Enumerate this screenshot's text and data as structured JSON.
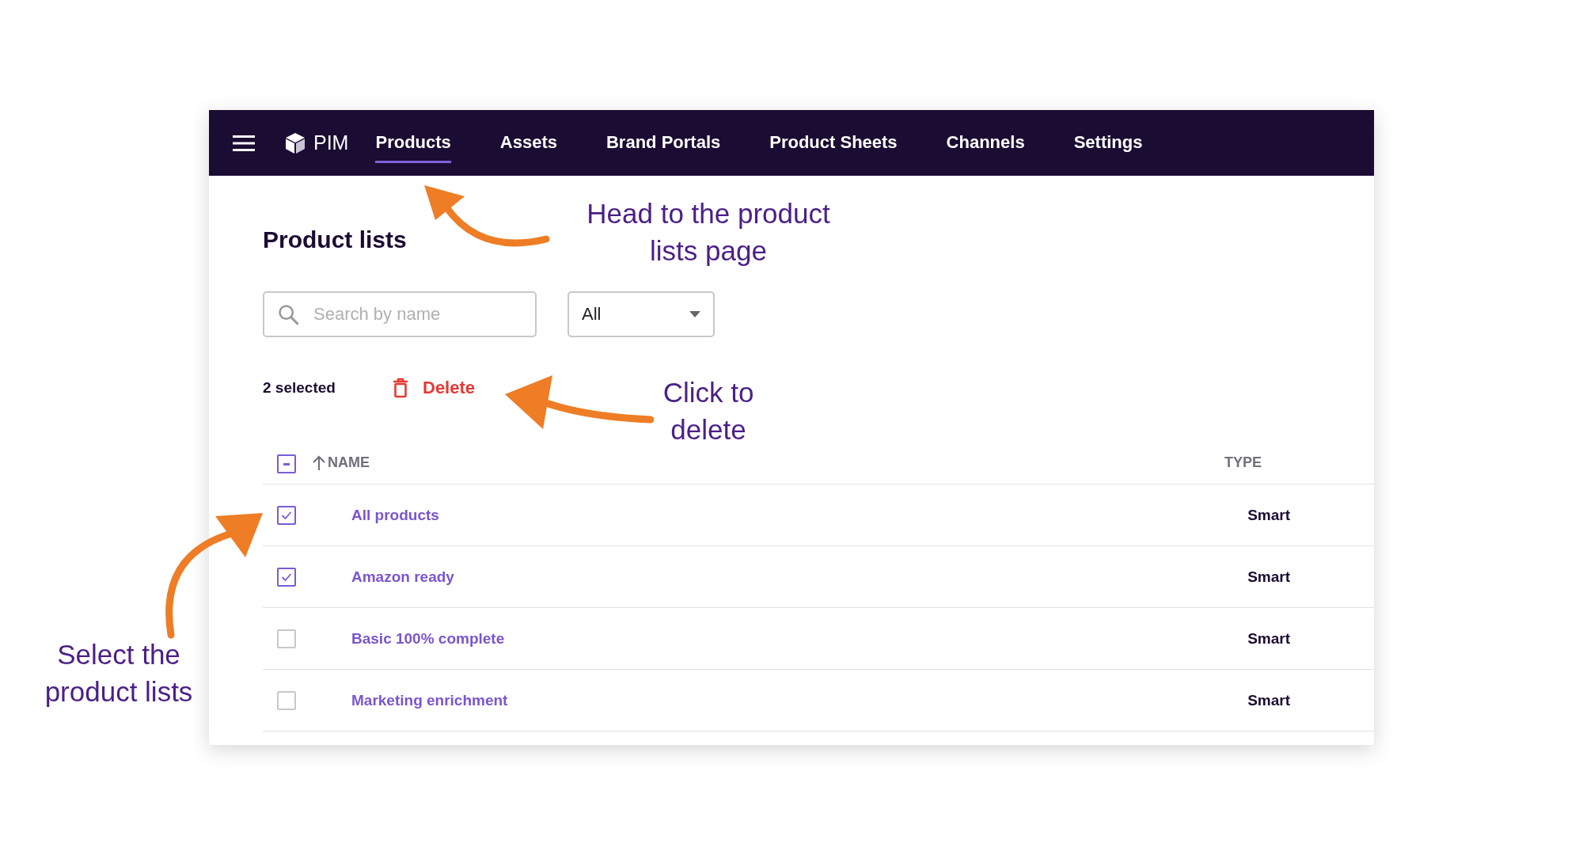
{
  "nav": {
    "app_name": "PIM",
    "tabs": [
      {
        "label": "Products",
        "selected": true
      },
      {
        "label": "Assets",
        "selected": false
      },
      {
        "label": "Brand Portals",
        "selected": false
      },
      {
        "label": "Product Sheets",
        "selected": false
      },
      {
        "label": "Channels",
        "selected": false
      },
      {
        "label": "Settings",
        "selected": false
      }
    ]
  },
  "page_title": "Product lists",
  "search": {
    "placeholder": "Search by name"
  },
  "filter": {
    "value": "All"
  },
  "selection": {
    "count_text": "2 selected",
    "delete_label": "Delete"
  },
  "table": {
    "select_all_partial": true,
    "columns": [
      "NAME",
      "TYPE"
    ],
    "rows": [
      {
        "name": "All products",
        "type": "Smart",
        "checked": true
      },
      {
        "name": "Amazon ready",
        "type": "Smart",
        "checked": true
      },
      {
        "name": "Basic 100% complete",
        "type": "Smart",
        "checked": false
      },
      {
        "name": "Marketing enrichment",
        "type": "Smart",
        "checked": false
      }
    ]
  },
  "annotations": [
    {
      "text": "Head to the product lists page",
      "kind": "nav"
    },
    {
      "text": "Click to delete",
      "kind": "delete"
    },
    {
      "text": "Select the product lists",
      "kind": "select"
    }
  ]
}
